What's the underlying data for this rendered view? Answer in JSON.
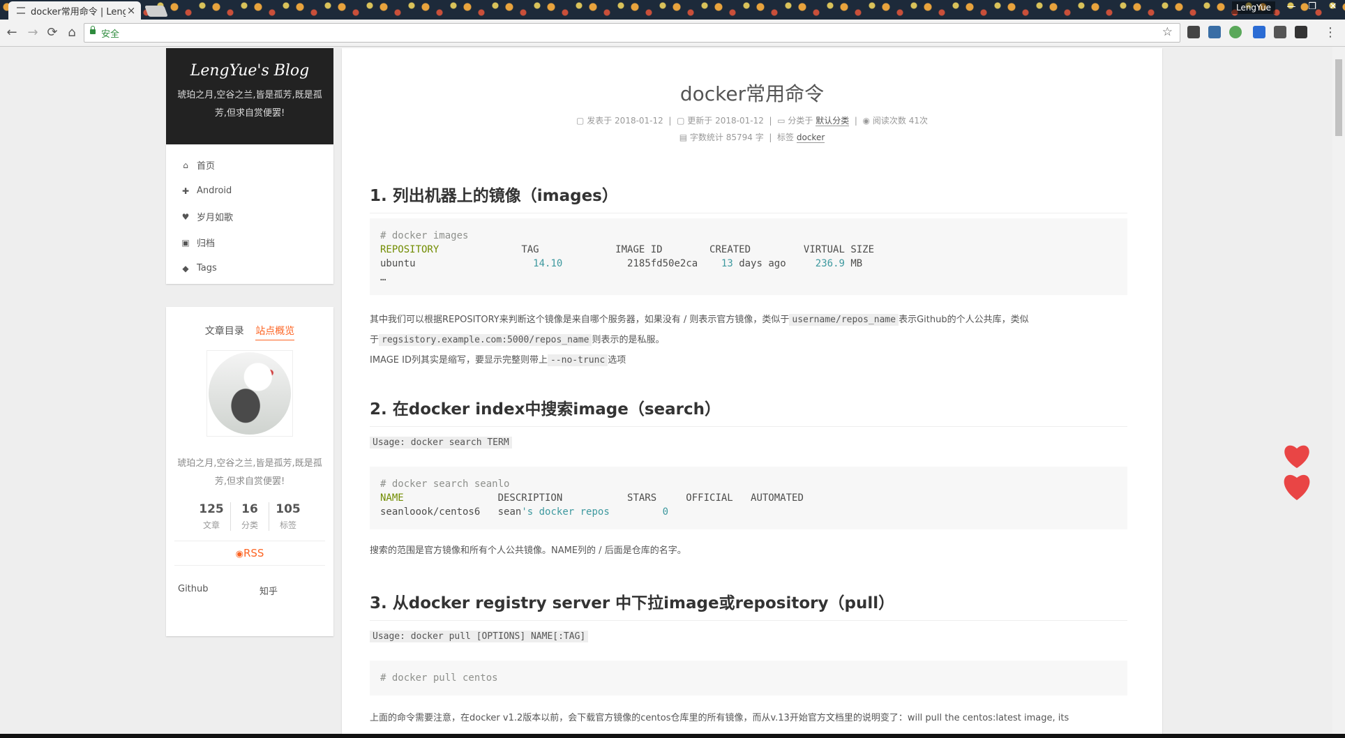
{
  "browser": {
    "tab_title": "docker常用命令 | Leng",
    "tab_close": "×",
    "window_user": "LengYue",
    "window_controls": [
      "—",
      "❐",
      "✕"
    ],
    "secure_label": "安全",
    "nav": {
      "back": "←",
      "forward": "→",
      "reload": "⟳",
      "home": "⌂"
    },
    "bookmark_icon": "☆",
    "menu_icon": "⋮"
  },
  "sidebar": {
    "brand": "LengYue's Blog",
    "subtitle": "琥珀之月,空谷之兰,皆是孤芳,既是孤芳,但求自赏便罢!",
    "menu": [
      {
        "icon": "home-icon",
        "glyph": "⌂",
        "label": "首页"
      },
      {
        "icon": "android-icon",
        "glyph": "✚",
        "label": "Android"
      },
      {
        "icon": "heart-icon",
        "glyph": "♥",
        "label": "岁月如歌"
      },
      {
        "icon": "archive-icon",
        "glyph": "▣",
        "label": "归档"
      },
      {
        "icon": "tags-icon",
        "glyph": "◆",
        "label": "Tags"
      }
    ],
    "tabs": {
      "toc": "文章目录",
      "overview": "站点概览"
    },
    "motto": "琥珀之月,空谷之兰,皆是孤芳,既是孤芳,但求自赏便罢!",
    "stats": [
      {
        "num": "125",
        "label": "文章"
      },
      {
        "num": "16",
        "label": "分类"
      },
      {
        "num": "105",
        "label": "标签"
      }
    ],
    "rss": "RSS",
    "rss_glyph": "⌂",
    "links": [
      "Github",
      "知乎"
    ]
  },
  "post": {
    "title": "docker常用命令",
    "meta1": {
      "posted_label": "发表于",
      "posted": "2018-01-12",
      "updated_label": "更新于",
      "updated": "2018-01-12",
      "category_label": "分类于",
      "category": "默认分类",
      "views_label": "阅读次数",
      "views": "41次"
    },
    "meta2": {
      "words_label": "字数统计",
      "words": "85794 字",
      "tags_label": "标签",
      "tag": "docker"
    },
    "sections": {
      "s1": {
        "heading": "1. 列出机器上的镜像（images）",
        "code_comment": "# docker images",
        "code_header_1": "REPOSITORY",
        "code_header_rest": "TAG             IMAGE ID        CREATED         VIRTUAL SIZE",
        "row_repo": "ubuntu",
        "row_tag": "14.10",
        "row_id": "2185fd50e2ca",
        "row_created_num": "13",
        "row_created_rest": " days ago",
        "row_size_num": "236.9",
        "row_size_unit": " MB",
        "ellipsis": "…",
        "p1_a": "其中我们可以根据REPOSITORY来判断这个镜像是来自哪个服务器，如果没有 / 则表示官方镜像，类似于",
        "p1_code": "username/repos_name",
        "p1_b": "表示Github的个人公共库，类似",
        "p2_a": "于",
        "p2_code": "regsistory.example.com:5000/repos_name",
        "p2_b": "则表示的是私服。",
        "p3_a": "IMAGE ID列其实是缩写，要显示完整则带上",
        "p3_code": "--no-trunc",
        "p3_b": "选项"
      },
      "s2": {
        "heading": "2. 在docker index中搜索image（search）",
        "usage": "Usage: docker search TERM",
        "code_comment": "# docker search seanlo",
        "header_name": "NAME",
        "header_rest": "DESCRIPTION           STARS     OFFICIAL   AUTOMATED",
        "row_name": "seanloook/centos6",
        "row_desc_a": "sean",
        "row_desc_b": "'s docker repos",
        "row_stars": "0",
        "p": "搜索的范围是官方镜像和所有个人公共镜像。NAME列的 / 后面是仓库的名字。"
      },
      "s3": {
        "heading": "3. 从docker registry server 中下拉image或repository（pull）",
        "usage": "Usage: docker pull [OPTIONS] NAME[:TAG]",
        "code_comment": "# docker pull centos",
        "p": "上面的命令需要注意，在docker v1.2版本以前，会下载官方镜像的centos仓库里的所有镜像，而从v.13开始官方文档里的说明变了：will pull the centos:latest image, its"
      }
    }
  },
  "colors": {
    "accent": "#fc6423",
    "heart": "#e83232",
    "secure": "#2e8b3d"
  }
}
